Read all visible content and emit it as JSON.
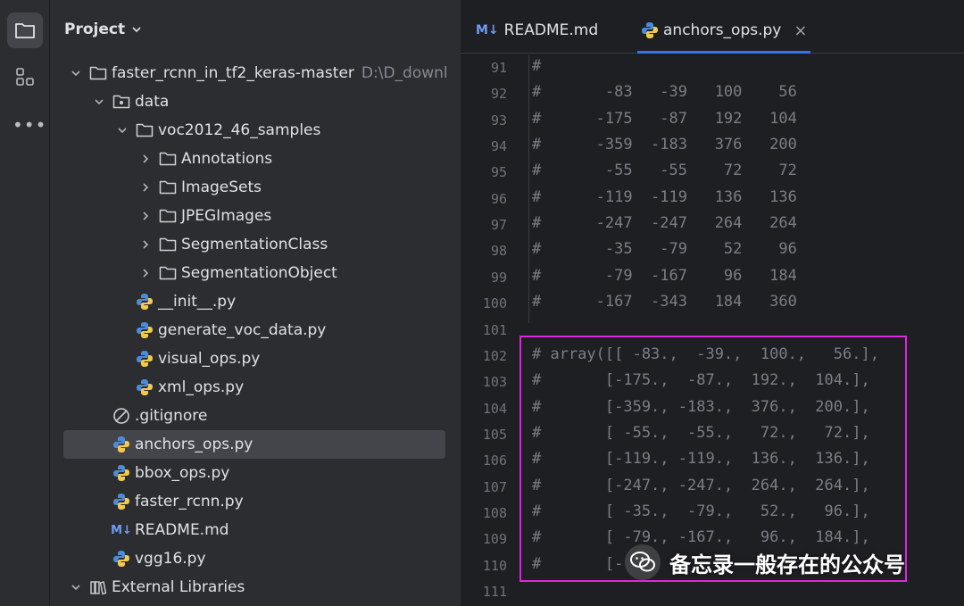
{
  "project_panel": {
    "title": "Project",
    "tree": [
      {
        "label": "faster_rcnn_in_tf2_keras-master",
        "hint": "D:\\D_downl",
        "icon": "folder-icon",
        "chevron": "down"
      },
      {
        "label": "data",
        "icon": "package-folder-icon",
        "chevron": "down"
      },
      {
        "label": "voc2012_46_samples",
        "icon": "folder-icon",
        "chevron": "down"
      },
      {
        "label": "Annotations",
        "icon": "folder-icon",
        "chevron": "right"
      },
      {
        "label": "ImageSets",
        "icon": "folder-icon",
        "chevron": "right"
      },
      {
        "label": "JPEGImages",
        "icon": "folder-icon",
        "chevron": "right"
      },
      {
        "label": "SegmentationClass",
        "icon": "folder-icon",
        "chevron": "right"
      },
      {
        "label": "SegmentationObject",
        "icon": "folder-icon",
        "chevron": "right"
      },
      {
        "label": "__init__.py",
        "icon": "python-file-icon"
      },
      {
        "label": "generate_voc_data.py",
        "icon": "python-file-icon"
      },
      {
        "label": "visual_ops.py",
        "icon": "python-file-icon"
      },
      {
        "label": "xml_ops.py",
        "icon": "python-file-icon"
      },
      {
        "label": ".gitignore",
        "icon": "ignore-file-icon"
      },
      {
        "label": "anchors_ops.py",
        "icon": "python-file-icon",
        "selected": true
      },
      {
        "label": "bbox_ops.py",
        "icon": "python-file-icon"
      },
      {
        "label": "faster_rcnn.py",
        "icon": "python-file-icon"
      },
      {
        "label": "README.md",
        "icon": "markdown-file-icon"
      },
      {
        "label": "vgg16.py",
        "icon": "python-file-icon"
      },
      {
        "label": "External Libraries",
        "icon": "libraries-icon",
        "chevron": "down"
      }
    ]
  },
  "tabs": [
    {
      "label": "README.md",
      "icon": "markdown-file-icon",
      "md_mark": "M↓"
    },
    {
      "label": "anchors_ops.py",
      "icon": "python-file-icon",
      "active": true
    }
  ],
  "editor": {
    "lines": [
      {
        "num": "91",
        "text": "#"
      },
      {
        "num": "92",
        "text": "#       -83   -39   100    56"
      },
      {
        "num": "93",
        "text": "#      -175   -87   192   104"
      },
      {
        "num": "94",
        "text": "#      -359  -183   376   200"
      },
      {
        "num": "95",
        "text": "#       -55   -55    72    72"
      },
      {
        "num": "96",
        "text": "#      -119  -119   136   136"
      },
      {
        "num": "97",
        "text": "#      -247  -247   264   264"
      },
      {
        "num": "98",
        "text": "#       -35   -79    52    96"
      },
      {
        "num": "99",
        "text": "#       -79  -167    96   184"
      },
      {
        "num": "100",
        "text": "#      -167  -343   184   360"
      },
      {
        "num": "101",
        "text": ""
      },
      {
        "num": "102",
        "text": "# array([[ -83.,  -39.,  100.,   56.],"
      },
      {
        "num": "103",
        "text": "#       [-175.,  -87.,  192.,  104.],"
      },
      {
        "num": "104",
        "text": "#       [-359., -183.,  376.,  200.],"
      },
      {
        "num": "105",
        "text": "#       [ -55.,  -55.,   72.,   72.],"
      },
      {
        "num": "106",
        "text": "#       [-119., -119.,  136.,  136.],"
      },
      {
        "num": "107",
        "text": "#       [-247., -247.,  264.,  264.],"
      },
      {
        "num": "108",
        "text": "#       [ -35.,  -79.,   52.,   96.],"
      },
      {
        "num": "109",
        "text": "#       [ -79., -167.,   96.,  184.],"
      },
      {
        "num": "110",
        "text": "#       [-"
      },
      {
        "num": "111",
        "text": ""
      }
    ]
  },
  "watermark": {
    "text": "备忘录一般存在的公众号",
    "icon": "wechat-icon"
  },
  "colors": {
    "highlight_border": "#e025e0",
    "selection": "#43454a",
    "accent": "#3574f0"
  }
}
